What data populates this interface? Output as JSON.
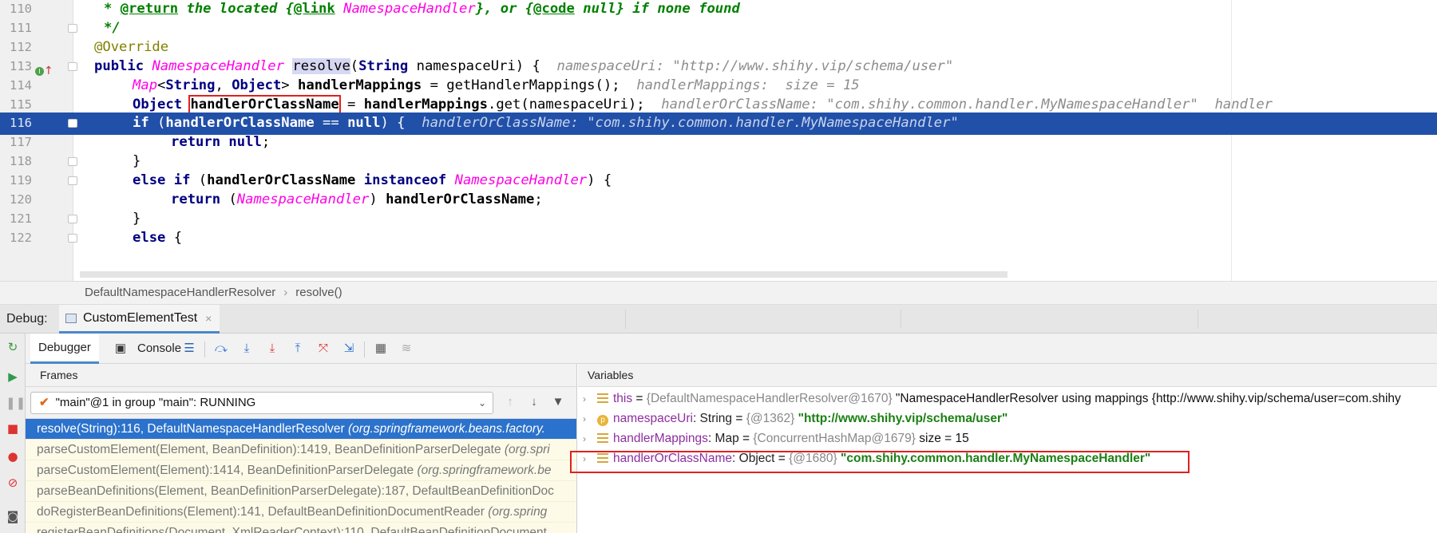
{
  "editor": {
    "lines": [
      {
        "num": "110",
        "parts": [
          [
            "doc",
            "* "
          ],
          [
            "doctag",
            "@return"
          ],
          [
            "doc",
            " the located {"
          ],
          [
            "doctag",
            "@link"
          ],
          [
            "doccls",
            " NamespaceHandler"
          ],
          [
            "doc",
            "}, or {"
          ],
          [
            "doctag",
            "@code"
          ],
          [
            "doc",
            " null} if none found"
          ]
        ]
      },
      {
        "num": "111",
        "parts": [
          [
            "doc",
            "*/"
          ]
        ]
      },
      {
        "num": "112",
        "parts": [
          [
            "ann",
            "@Override"
          ]
        ]
      },
      {
        "num": "113",
        "parts": [
          [
            "kw",
            "public "
          ],
          [
            "cls",
            "NamespaceHandler "
          ],
          [
            "mref",
            "resolve"
          ],
          [
            "txt",
            "("
          ],
          [
            "kw",
            "String"
          ],
          [
            "txt",
            " namespaceUri) {  "
          ],
          [
            "hint",
            "namespaceUri: \"http://www.shihy.vip/schema/user\""
          ]
        ]
      },
      {
        "num": "114",
        "parts": [
          [
            "cls",
            "Map"
          ],
          [
            "txt",
            "<"
          ],
          [
            "kw",
            "String"
          ],
          [
            "txt",
            ", "
          ],
          [
            "kw",
            "Object"
          ],
          [
            "txt",
            "> "
          ],
          [
            "var",
            "handlerMappings"
          ],
          [
            "txt",
            " = getHandlerMappings();  "
          ],
          [
            "hint",
            "handlerMappings:  size = 15"
          ]
        ]
      },
      {
        "num": "115",
        "parts": [
          [
            "kw",
            "Object "
          ],
          [
            "boxvar",
            "handlerOrClassName"
          ],
          [
            "txt",
            " = "
          ],
          [
            "var",
            "handlerMappings"
          ],
          [
            "txt",
            ".get(namespaceUri);  "
          ],
          [
            "hint",
            "handlerOrClassName: \"com.shihy.common.handler.MyNamespaceHandler\"  handler"
          ]
        ]
      },
      {
        "num": "116",
        "parts": [
          [
            "kw",
            "if"
          ],
          [
            "txt",
            " ("
          ],
          [
            "var",
            "handlerOrClassName"
          ],
          [
            "txt",
            " == "
          ],
          [
            "kw",
            "null"
          ],
          [
            "txt",
            ") {  "
          ],
          [
            "hint",
            "handlerOrClassName: \"com.shihy.common.handler.MyNamespaceHandler\""
          ]
        ]
      },
      {
        "num": "117",
        "parts": [
          [
            "kw",
            "return null"
          ],
          [
            "txt",
            ";"
          ]
        ]
      },
      {
        "num": "118",
        "parts": [
          [
            "txt",
            "}"
          ]
        ]
      },
      {
        "num": "119",
        "parts": [
          [
            "kw",
            "else if"
          ],
          [
            "txt",
            " ("
          ],
          [
            "var",
            "handlerOrClassName"
          ],
          [
            "kw",
            " instanceof "
          ],
          [
            "cls",
            "NamespaceHandler"
          ],
          [
            "txt",
            ") {"
          ]
        ]
      },
      {
        "num": "120",
        "parts": [
          [
            "kw",
            "return"
          ],
          [
            "txt",
            " ("
          ],
          [
            "cls",
            "NamespaceHandler"
          ],
          [
            "txt",
            ") "
          ],
          [
            "var",
            "handlerOrClassName"
          ],
          [
            "txt",
            ";"
          ]
        ]
      },
      {
        "num": "121",
        "parts": [
          [
            "txt",
            "}"
          ]
        ]
      },
      {
        "num": "122",
        "parts": [
          [
            "kw",
            "else"
          ],
          [
            "txt",
            " {"
          ]
        ]
      }
    ]
  },
  "breadcrumb": {
    "items": [
      "DefaultNamespaceHandlerResolver",
      "resolve()"
    ],
    "separator": "›"
  },
  "debug": {
    "label": "Debug:",
    "tab_label": "CustomElementTest",
    "close_glyph": "×"
  },
  "toolbar": {
    "debugger_tab": "Debugger",
    "console_tab": "Console"
  },
  "frames": {
    "title": "Frames",
    "thread": "\"main\"@1 in group \"main\": RUNNING",
    "rows": [
      {
        "text": "resolve(String):116, DefaultNamespaceHandlerResolver ",
        "pkg": "(org.springframework.beans.factory.",
        "selected": true
      },
      {
        "text": "parseCustomElement(Element, BeanDefinition):1419, BeanDefinitionParserDelegate ",
        "pkg": "(org.spri",
        "selected": false
      },
      {
        "text": "parseCustomElement(Element):1414, BeanDefinitionParserDelegate ",
        "pkg": "(org.springframework.be",
        "selected": false
      },
      {
        "text": "parseBeanDefinitions(Element, BeanDefinitionParserDelegate):187, DefaultBeanDefinitionDoc",
        "pkg": "",
        "selected": false
      },
      {
        "text": "doRegisterBeanDefinitions(Element):141, DefaultBeanDefinitionDocumentReader ",
        "pkg": "(org.spring",
        "selected": false
      },
      {
        "text": "registerBeanDefinitions(Document, XmlReaderContext):110, DefaultBeanDefinitionDocument",
        "pkg": "",
        "selected": false
      }
    ]
  },
  "variables": {
    "title": "Variables",
    "rows": [
      {
        "icon": "field",
        "name": "this",
        "type": "",
        "ref": "{DefaultNamespaceHandlerResolver@1670}",
        "value": " \"NamespaceHandlerResolver using mappings {http://www.shihy.vip/schema/user=com.shihy",
        "value_style": "plain"
      },
      {
        "icon": "param",
        "name": "namespaceUri",
        "type": ": String",
        "ref": "{@1362}",
        "value": " \"http://www.shihy.vip/schema/user\"",
        "value_style": "string"
      },
      {
        "icon": "field",
        "name": "handlerMappings",
        "type": ": Map",
        "ref": "{ConcurrentHashMap@1679}",
        "value": "  size = 15",
        "value_style": "plain"
      },
      {
        "icon": "field",
        "name": "handlerOrClassName",
        "type": ": Object",
        "ref": "{@1680}",
        "value": " \"com.shihy.common.handler.MyNamespaceHandler\"",
        "value_style": "string"
      }
    ]
  },
  "colors": {
    "exec_line": "#2150a8",
    "selected_frame": "#2b72cc",
    "highlight_box": "#e02020",
    "keyword": "#000080",
    "class_ref": "#ff00e6",
    "string_value": "#1b7f14"
  }
}
